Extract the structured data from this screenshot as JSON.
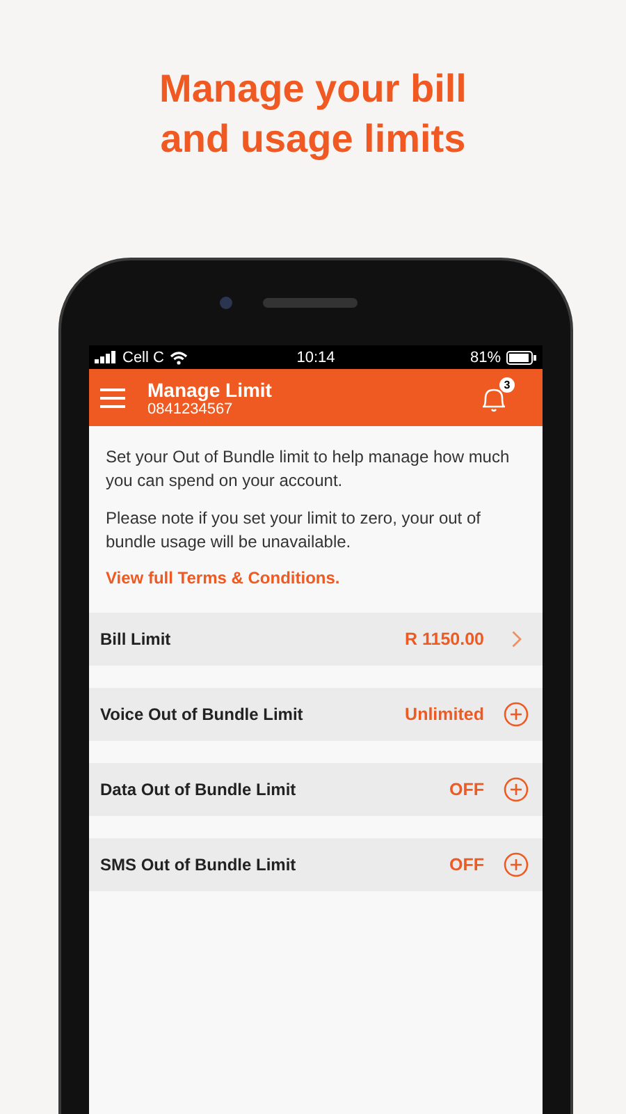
{
  "headline": "Manage your bill and usage limits",
  "status_bar": {
    "carrier": "Cell C",
    "time": "10:14",
    "battery": "81%"
  },
  "header": {
    "title": "Manage Limit",
    "subtitle": "0841234567",
    "notification_count": "3"
  },
  "intro": [
    "Set your Out of Bundle limit to help manage how much you can spend on your account.",
    "Please note if you set your limit to zero, your out of bundle usage will be unavailable."
  ],
  "terms_link": "View full Terms & Conditions.",
  "limits": [
    {
      "label": "Bill Limit",
      "value": "R 1150.00",
      "kind": "chevron"
    },
    {
      "label": "Voice Out of Bundle Limit",
      "value": "Unlimited",
      "kind": "plus"
    },
    {
      "label": "Data Out of Bundle Limit",
      "value": "OFF",
      "kind": "plus"
    },
    {
      "label": "SMS Out of Bundle Limit",
      "value": "OFF",
      "kind": "plus"
    }
  ]
}
